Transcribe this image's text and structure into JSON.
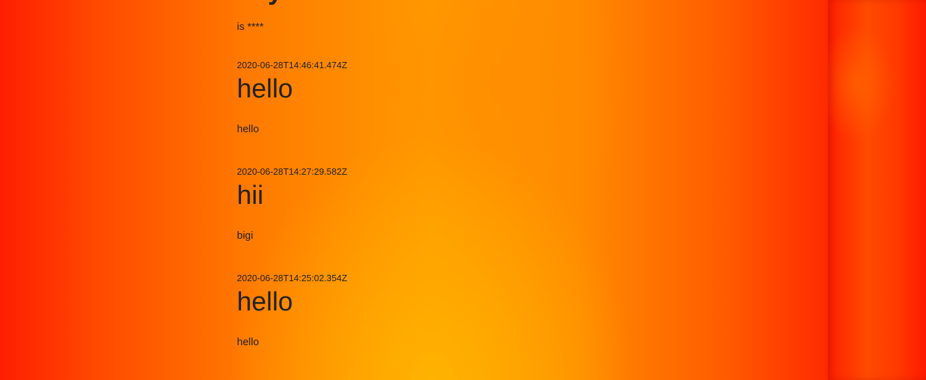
{
  "first_post": {
    "title": "hey",
    "body": "is ****"
  },
  "posts": [
    {
      "timestamp": "2020-06-28T14:46:41.474Z",
      "title": "hello",
      "body": "hello"
    },
    {
      "timestamp": "2020-06-28T14:27:29.582Z",
      "title": "hii",
      "body": "bigi"
    },
    {
      "timestamp": "2020-06-28T14:25:02.354Z",
      "title": "hello",
      "body": "hello"
    }
  ],
  "colors": {
    "text": "#222222",
    "background_top": "#ff4a00",
    "background_center": "#ffa000",
    "edge_red": "#ff1e00"
  }
}
